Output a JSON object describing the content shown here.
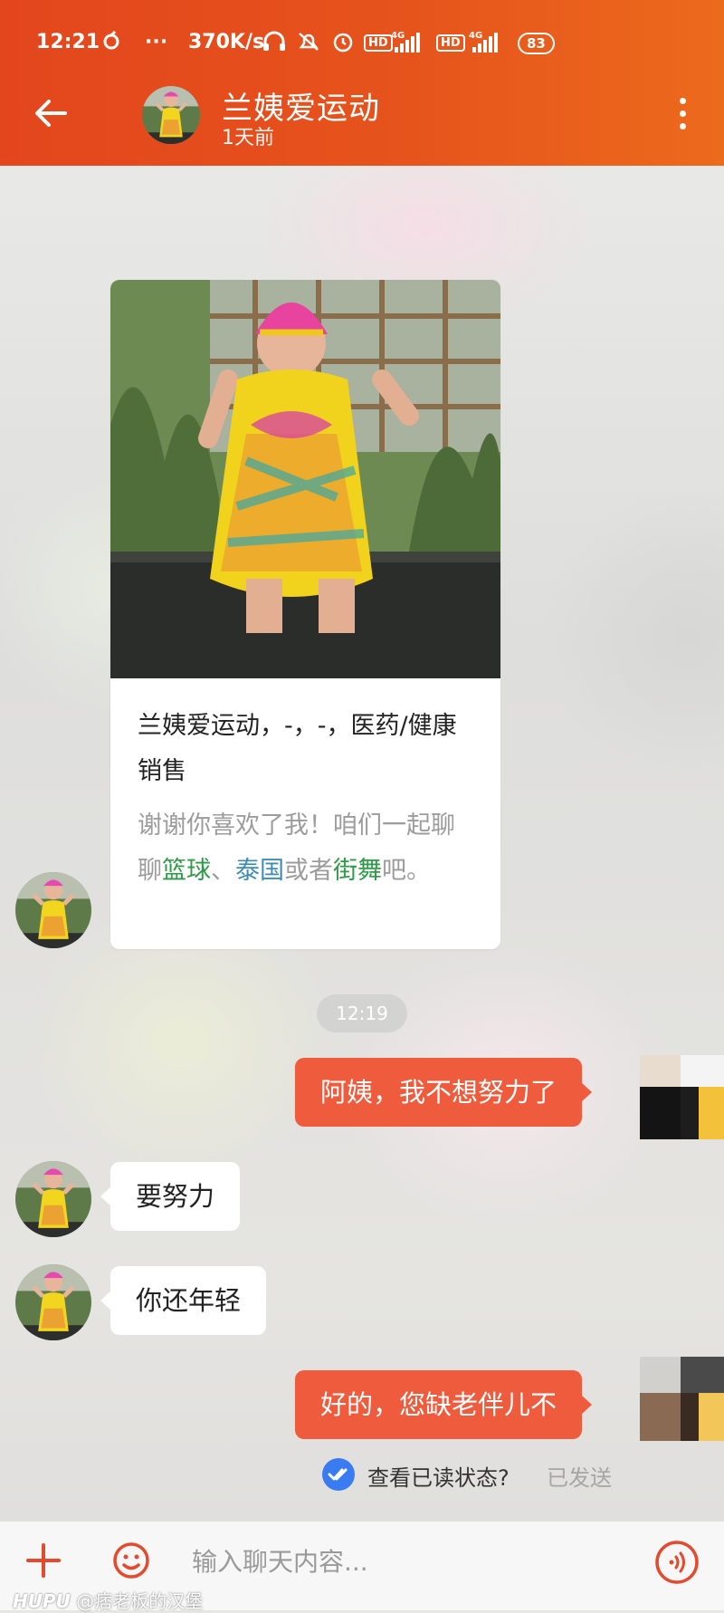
{
  "status_bar": {
    "time": "12:21",
    "dots": "···",
    "net_speed": "370K/s",
    "hd1": "HD",
    "net1": "4G",
    "hd2": "HD",
    "net2": "4G",
    "battery": "83"
  },
  "header": {
    "contact_name": "兰姨爱运动",
    "last_seen": "1天前"
  },
  "profile_card": {
    "title": "兰姨爱运动，-，-，医药/健康 销售",
    "desc_1": "谢谢你喜欢了我！咱们一起聊聊",
    "kw_1": "篮球",
    "sep": "、",
    "kw_2": "泰国",
    "desc_2": "或者",
    "kw_3": "街舞",
    "desc_3": "吧。"
  },
  "timestamp": "12:19",
  "messages": [
    {
      "from": "me",
      "text": "阿姨，我不想努力了"
    },
    {
      "from": "them",
      "text": "要努力"
    },
    {
      "from": "them",
      "text": "你还年轻"
    },
    {
      "from": "me",
      "text": "好的，您缺老伴儿不"
    }
  ],
  "read_status": {
    "link": "查看已读状态?",
    "sent": "已发送"
  },
  "input_bar": {
    "placeholder": "输入聊天内容..."
  },
  "watermark": {
    "brand": "HUPU",
    "handle": " @痞老板的汉堡"
  },
  "colors": {
    "header": "#e6531c",
    "my_bubble": "#ef5b3d",
    "keyword_green": "#2f9a47",
    "keyword_blue": "#3f8bb8",
    "read_icon": "#3b7bf2"
  }
}
